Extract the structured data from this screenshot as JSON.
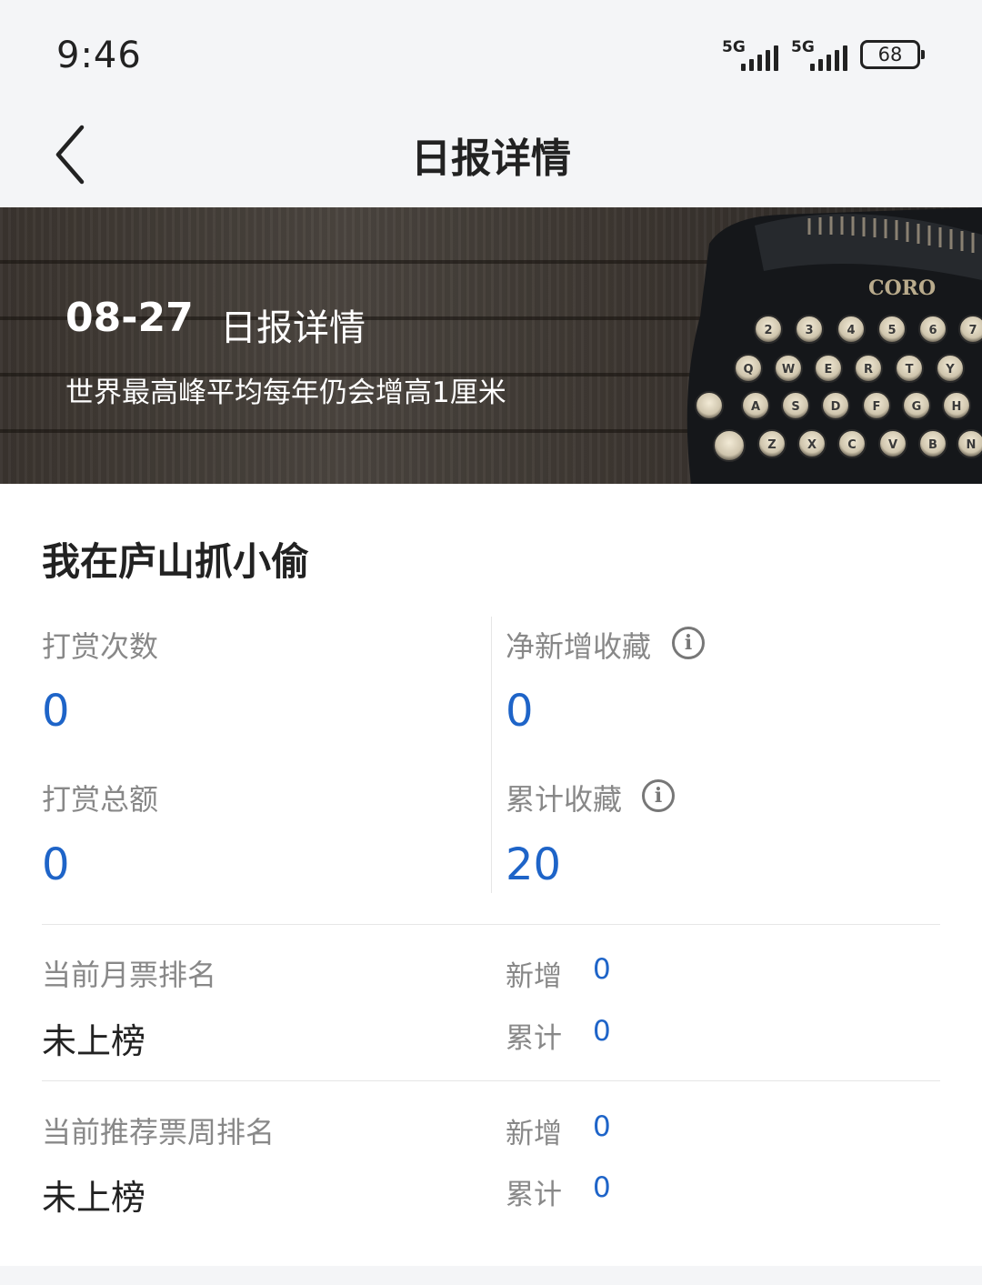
{
  "status_bar": {
    "time": "9:46",
    "signal_1": "5G",
    "signal_2": "5G",
    "battery": "68"
  },
  "nav": {
    "back_icon": "chevron-left-icon",
    "title": "日报详情"
  },
  "banner": {
    "date": "08-27",
    "heading": "日报详情",
    "subtitle": "世界最高峰平均每年仍会增高1厘米"
  },
  "book": {
    "title": "我在庐山抓小偷"
  },
  "stats": {
    "tip_count_label": "打赏次数",
    "tip_count_value": "0",
    "tip_total_label": "打赏总额",
    "tip_total_value": "0",
    "net_fav_label": "净新增收藏",
    "net_fav_value": "0",
    "total_fav_label": "累计收藏",
    "total_fav_value": "20"
  },
  "monthly_ticket": {
    "label": "当前月票排名",
    "rank": "未上榜",
    "new_label": "新增",
    "new_value": "0",
    "total_label": "累计",
    "total_value": "0"
  },
  "weekly_recommend": {
    "label": "当前推荐票周排名",
    "rank": "未上榜",
    "new_label": "新增",
    "new_value": "0",
    "total_label": "累计",
    "total_value": "0"
  },
  "colors": {
    "accent": "#1e64c8",
    "background": "#f4f5f7"
  }
}
